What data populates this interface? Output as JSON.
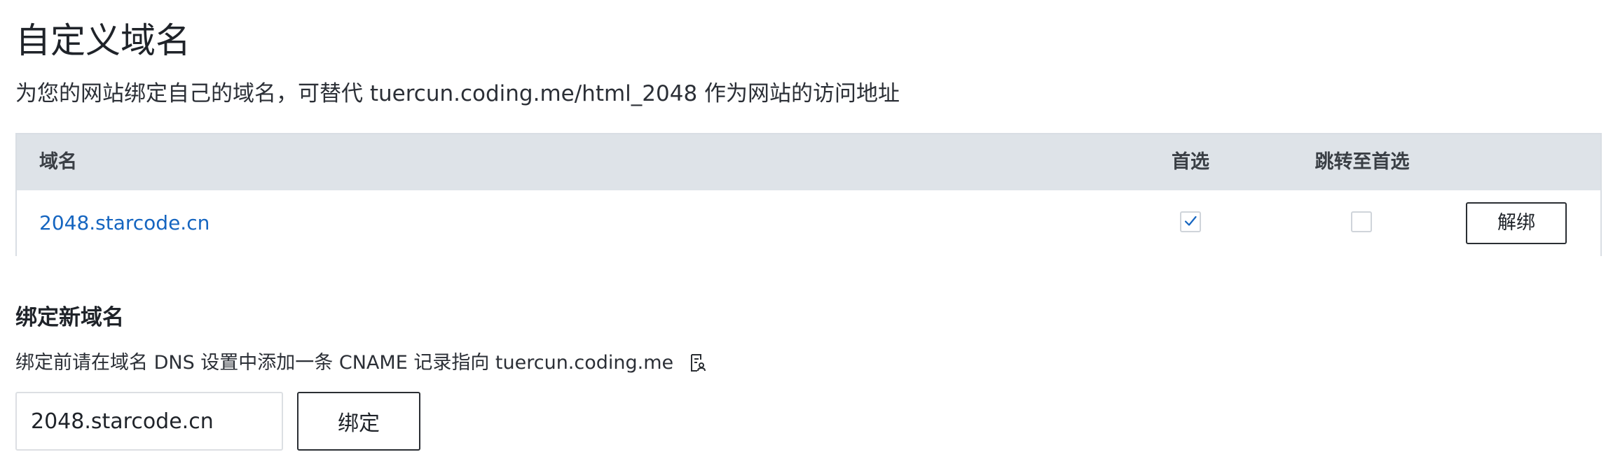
{
  "page": {
    "title": "自定义域名",
    "description": "为您的网站绑定自己的域名，可替代 tuercun.coding.me/html_2048 作为网站的访问地址"
  },
  "table": {
    "columns": {
      "domain": "域名",
      "preferred": "首选",
      "redirect": "跳转至首选"
    },
    "rows": [
      {
        "domain": "2048.starcode.cn",
        "preferred": true,
        "redirect_to_preferred": false,
        "action_label": "解绑"
      }
    ]
  },
  "bind_section": {
    "title": "绑定新域名",
    "hint": "绑定前请在域名 DNS 设置中添加一条 CNAME 记录指向 tuercun.coding.me",
    "hint_icon": "copy-icon",
    "input_value": "2048.starcode.cn",
    "button_label": "绑定"
  },
  "colors": {
    "link": "#1565c0",
    "header_bg": "#dee3e8",
    "border": "#d9dee4"
  }
}
